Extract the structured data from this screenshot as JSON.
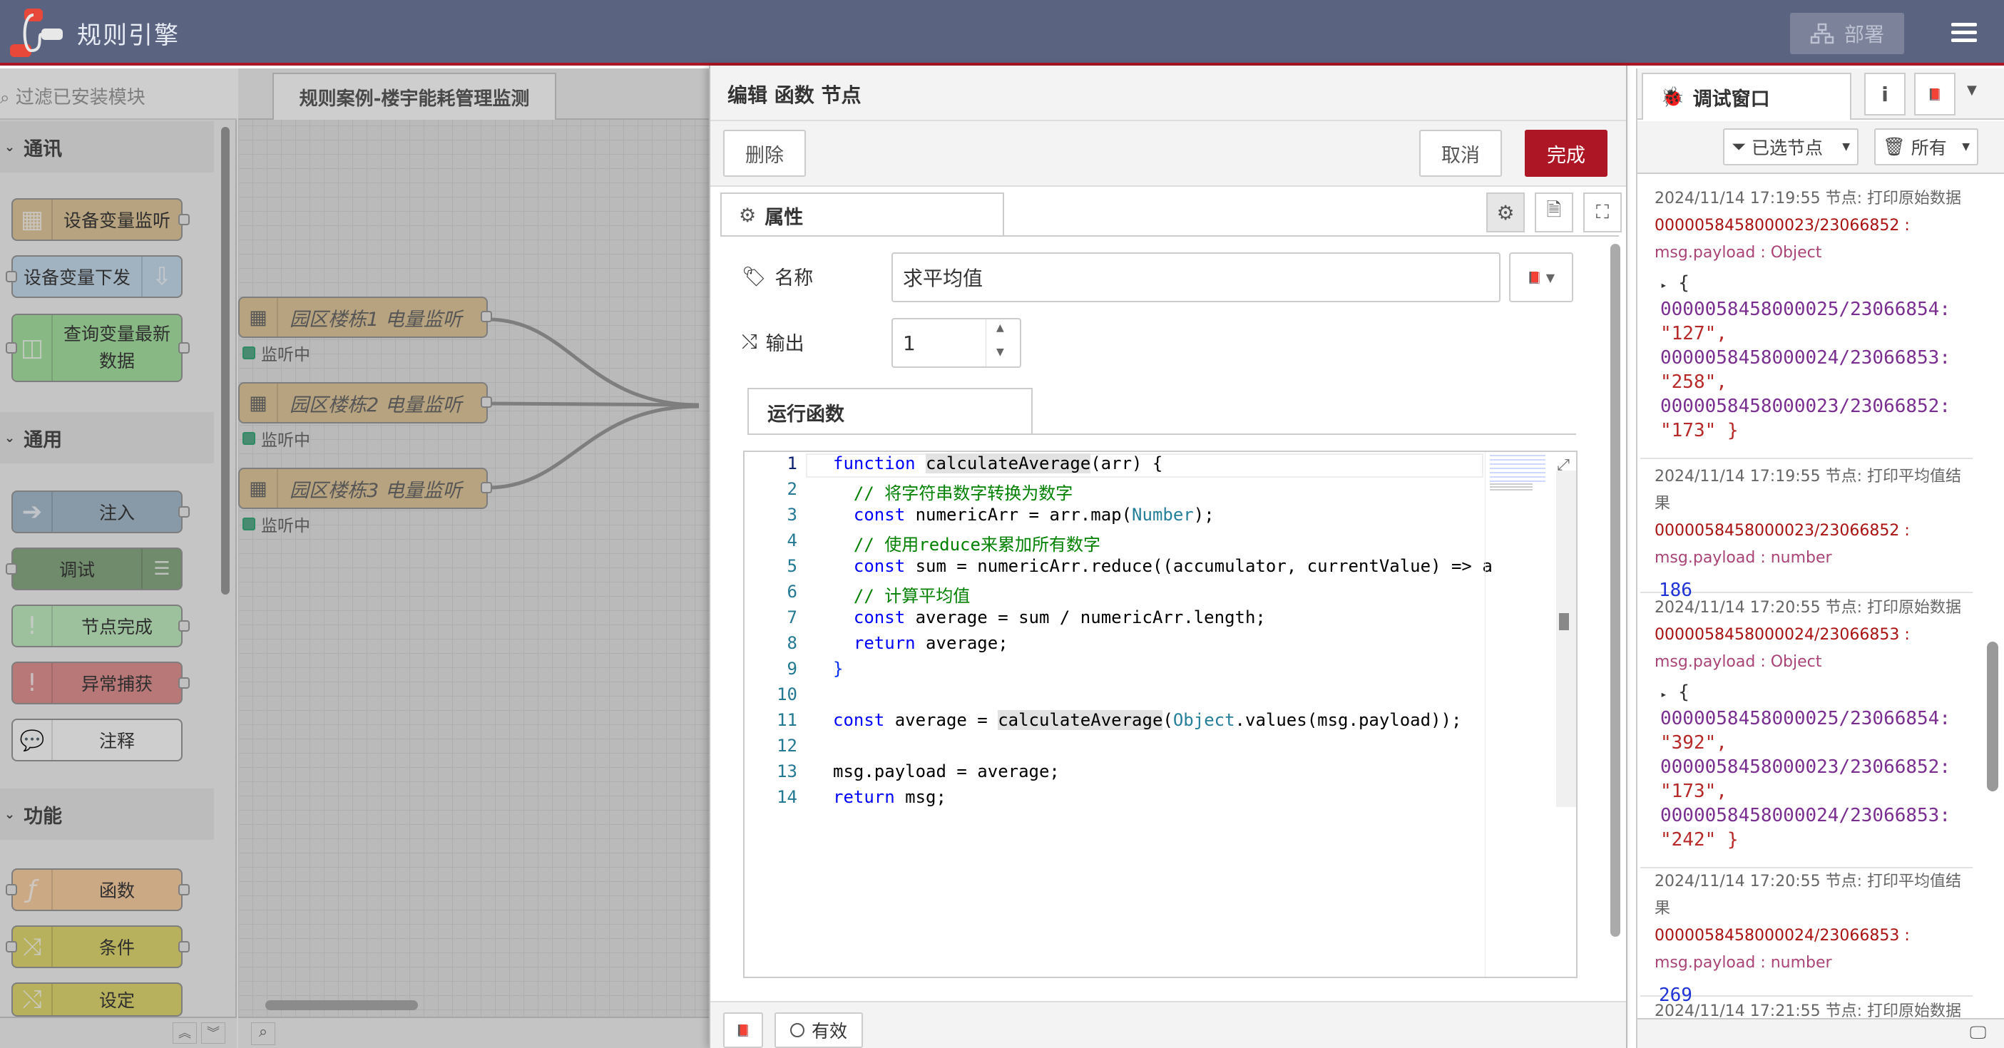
{
  "header": {
    "title": "规则引擎",
    "deploy_label": "部署"
  },
  "palette": {
    "search_placeholder": "过滤已安装模块",
    "categories": [
      {
        "label": "通讯",
        "nodes": [
          "设备变量监听",
          "设备变量下发",
          "查询变量最新数据"
        ]
      },
      {
        "label": "通用",
        "nodes": [
          "注入",
          "调试",
          "节点完成",
          "异常捕获",
          "注释"
        ]
      },
      {
        "label": "功能",
        "nodes": [
          "函数",
          "条件",
          "设定"
        ]
      }
    ]
  },
  "workspace": {
    "tab_label": "规则案例-楼宇能耗管理监测",
    "nodes": [
      {
        "label": "园区楼栋1 电量监听",
        "status": "监听中"
      },
      {
        "label": "园区楼栋2 电量监听",
        "status": "监听中"
      },
      {
        "label": "园区楼栋3 电量监听",
        "status": "监听中"
      }
    ]
  },
  "editor": {
    "title": "编辑 函数 节点",
    "delete_label": "删除",
    "cancel_label": "取消",
    "done_label": "完成",
    "properties_tab": "属性",
    "name_label": "名称",
    "name_value": "求平均值",
    "outputs_label": "输出",
    "outputs_value": "1",
    "function_tab": "运行函数",
    "enabled_label": "有效",
    "line_numbers": [
      "1",
      "2",
      "3",
      "4",
      "5",
      "6",
      "7",
      "8",
      "9",
      "10",
      "11",
      "12",
      "13",
      "14"
    ],
    "code": {
      "l1_kw": "function",
      "l1_fn": "calculateAverage",
      "l1_rest": "(arr) {",
      "l2": "  // 将字符串数字转换为数字",
      "l3_kw": "  const",
      "l3_a": " numericArr = arr.map(",
      "l3_ty": "Number",
      "l3_b": ");",
      "l4": "  // 使用reduce来累加所有数字",
      "l5_kw": "  const",
      "l5_rest": " sum = numericArr.reduce((accumulator, currentValue) => a",
      "l6": "  // 计算平均值",
      "l7_kw": "  const",
      "l7_rest": " average = sum / numericArr.length;",
      "l8_kw": "  return",
      "l8_rest": " average;",
      "l9": "}",
      "l11_kw": "const",
      "l11_a": " average = ",
      "l11_fn": "calculateAverage",
      "l11_b": "(",
      "l11_ty": "Object",
      "l11_c": ".values(msg.payload));",
      "l13": "msg.payload = average;",
      "l14_kw": "return",
      "l14_rest": " msg;"
    }
  },
  "sidebar": {
    "tab_label": "调试窗口",
    "filter_selected": "已选节点",
    "filter_all": "所有",
    "messages": [
      {
        "meta": "2024/11/14 17:19:55   节点: 打印原始数据",
        "path": "0000058458000023/23066852 :",
        "type": "msg.payload : Object",
        "obj": [
          [
            "0000058458000025/23066854:",
            "\"127\","
          ],
          [
            "0000058458000024/23066853:",
            "\"258\","
          ],
          [
            "0000058458000023/23066852:",
            "\"173\"  }"
          ]
        ]
      },
      {
        "meta": "2024/11/14 17:19:55   节点: 打印平均值结果",
        "path": "0000058458000023/23066852 :",
        "type": "msg.payload : number",
        "value": "186"
      },
      {
        "meta": "2024/11/14 17:20:55   节点: 打印原始数据",
        "path": "0000058458000024/23066853 :",
        "type": "msg.payload : Object",
        "obj": [
          [
            "0000058458000025/23066854:",
            "\"392\","
          ],
          [
            "0000058458000023/23066852:",
            "\"173\","
          ],
          [
            "0000058458000024/23066853:",
            "\"242\"  }"
          ]
        ]
      },
      {
        "meta": "2024/11/14 17:20:55   节点: 打印平均值结果",
        "path": "0000058458000024/23066853 :",
        "type": "msg.payload : number",
        "value": "269"
      },
      {
        "meta": "2024/11/14 17:21:55   节点: 打印原始数据"
      }
    ]
  },
  "colors": {
    "header": "#5a6481",
    "accent": "#ad1625",
    "function_node": "#e2c89a"
  }
}
